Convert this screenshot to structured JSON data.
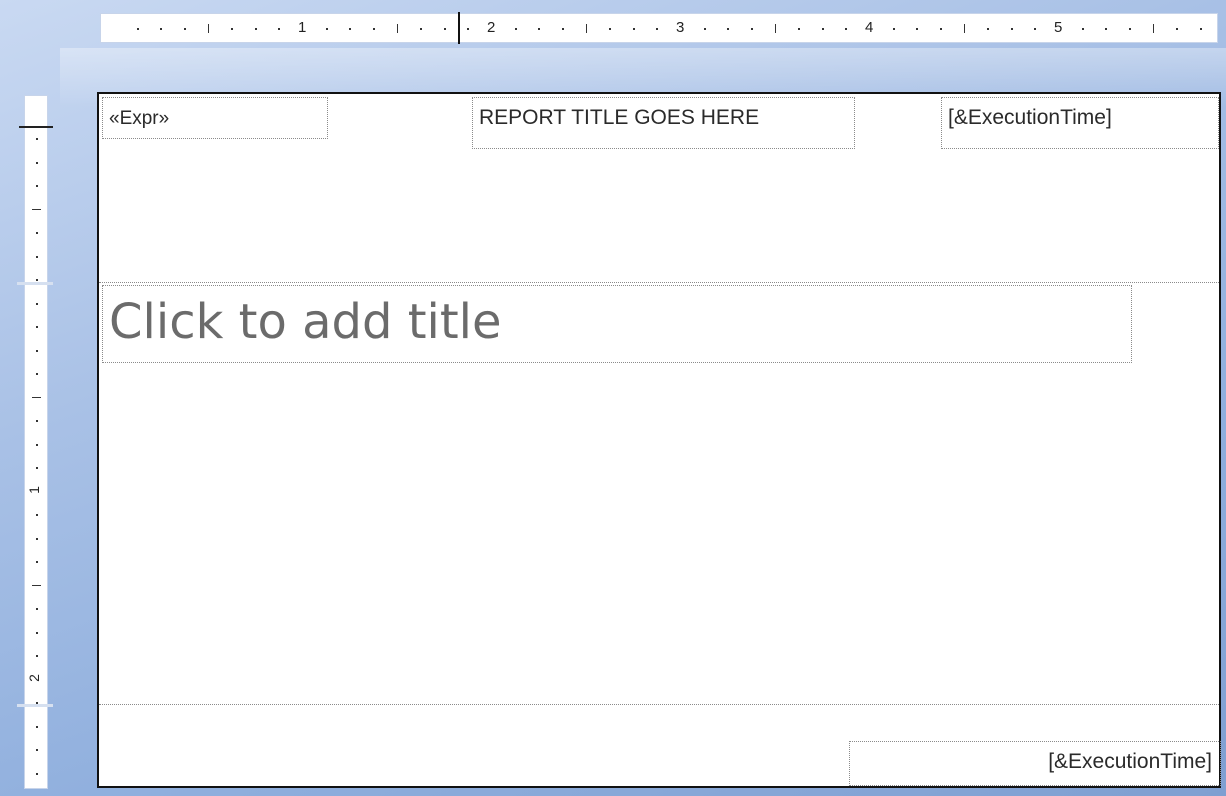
{
  "ruler": {
    "horizontal_labels": [
      "1",
      "2",
      "3",
      "4",
      "5"
    ],
    "vertical_labels": [
      "1",
      "2"
    ]
  },
  "report": {
    "header": {
      "expr_field": "«Expr»",
      "title_field": "REPORT TITLE GOES HERE",
      "execution_time_field": "[&ExecutionTime]"
    },
    "body": {
      "title_placeholder": "Click to add title"
    },
    "footer": {
      "execution_time_field": "[&ExecutionTime]"
    }
  },
  "colors": {
    "workspace_blue": "#8eaedd",
    "page_border": "#111111",
    "placeholder_gray": "#6b6b6b"
  }
}
